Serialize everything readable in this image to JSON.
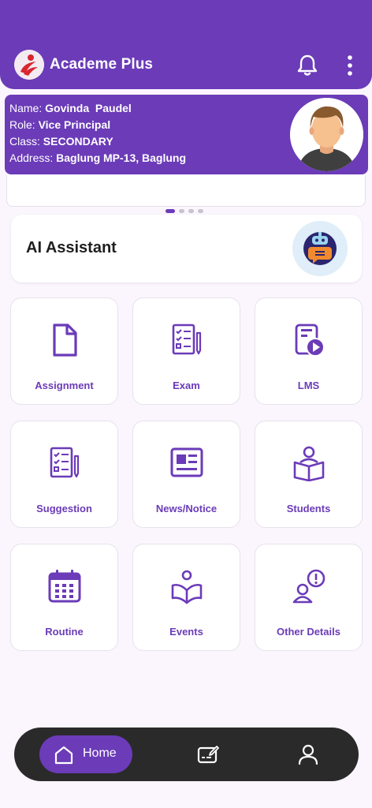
{
  "app": {
    "title": "Academe Plus"
  },
  "profile": {
    "name_label": "Name: ",
    "name": "Govinda  Paudel",
    "role_label": "Role: ",
    "role": "Vice Principal",
    "class_label": "Class: ",
    "class": "SECONDARY",
    "address_label": "Address: ",
    "address": "Baglung MP-13, Baglung"
  },
  "carousel": {
    "pages": 4,
    "active": 0
  },
  "ai": {
    "title": "AI Assistant"
  },
  "tiles": [
    {
      "label": "Assignment",
      "icon": "document-icon"
    },
    {
      "label": "Exam",
      "icon": "exam-checklist-icon"
    },
    {
      "label": "LMS",
      "icon": "lms-play-icon"
    },
    {
      "label": "Suggestion",
      "icon": "suggestion-checklist-icon"
    },
    {
      "label": "News/Notice",
      "icon": "newspaper-icon"
    },
    {
      "label": "Students",
      "icon": "student-reading-icon"
    },
    {
      "label": "Routine",
      "icon": "calendar-icon"
    },
    {
      "label": "Events",
      "icon": "events-book-icon"
    },
    {
      "label": "Other Details",
      "icon": "person-info-icon"
    }
  ],
  "nav": {
    "home_label": "Home"
  },
  "colors": {
    "primary": "#6b3bb8",
    "nav_bg": "#2a2a2a",
    "background": "#fbf5fd"
  }
}
